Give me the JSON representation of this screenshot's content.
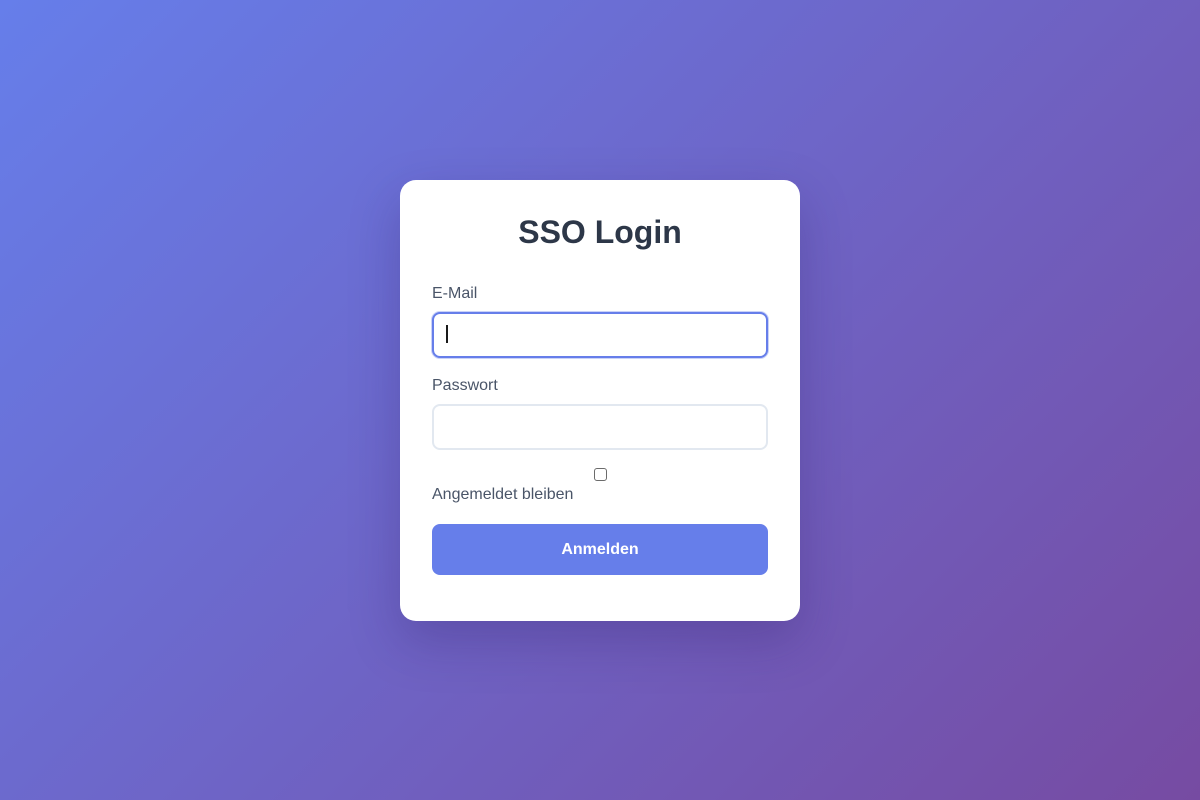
{
  "login": {
    "title": "SSO Login",
    "email_label": "E-Mail",
    "email_value": "",
    "password_label": "Passwort",
    "password_value": "",
    "remember_label": "Angemeldet bleiben",
    "remember_checked": false,
    "submit_label": "Anmelden"
  },
  "colors": {
    "background_gradient_start": "#667eea",
    "background_gradient_end": "#764ba2",
    "accent": "#667eea",
    "text_primary": "#2d3748",
    "text_label": "#4a5568",
    "input_border": "#e2e8f0"
  }
}
